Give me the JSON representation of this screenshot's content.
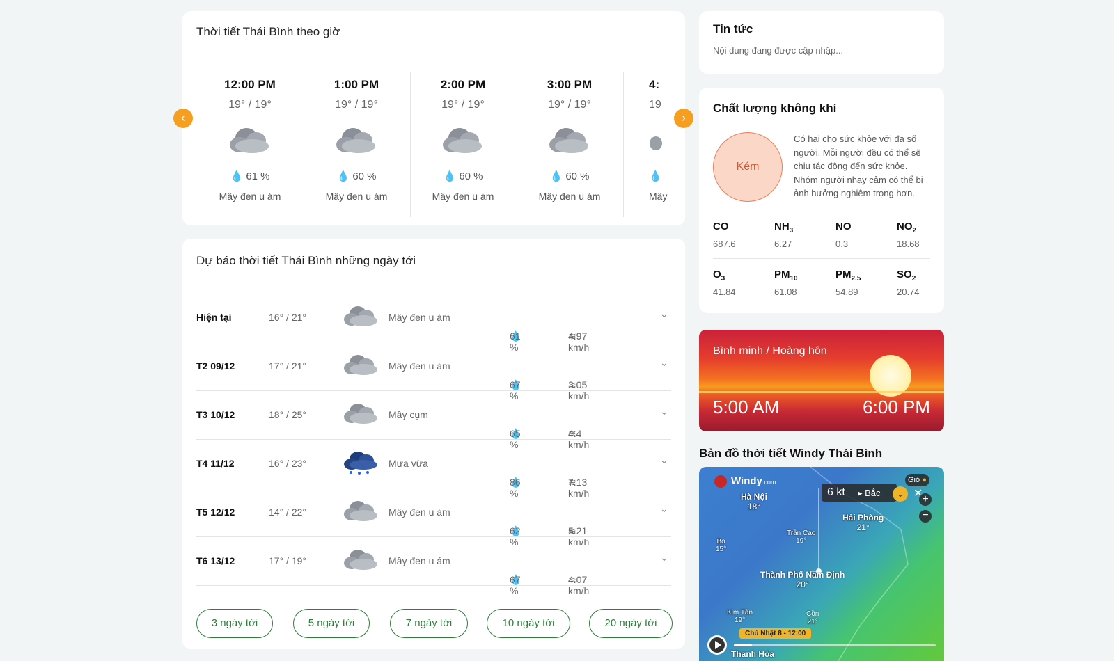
{
  "hourly": {
    "title": "Thời tiết Thái Bình theo giờ",
    "items": [
      {
        "time": "12:00 PM",
        "temp": "19° / 19°",
        "humidity": "61 %",
        "desc": "Mây đen u ám"
      },
      {
        "time": "1:00 PM",
        "temp": "19° / 19°",
        "humidity": "60 %",
        "desc": "Mây đen u ám"
      },
      {
        "time": "2:00 PM",
        "temp": "19° / 19°",
        "humidity": "60 %",
        "desc": "Mây đen u ám"
      },
      {
        "time": "3:00 PM",
        "temp": "19° / 19°",
        "humidity": "60 %",
        "desc": "Mây đen u ám"
      },
      {
        "time": "4:",
        "temp": "19",
        "humidity": "",
        "desc": "Mây"
      }
    ],
    "prev_label": "‹",
    "next_label": "›"
  },
  "forecast": {
    "title": "Dự báo thời tiết Thái Bình những ngày tới",
    "rows": [
      {
        "day": "Hiện tại",
        "temp": "16° / 21°",
        "desc": "Mây đen u ám",
        "humidity": "61 %",
        "wind": "4.97 km/h",
        "icon": "cloud-icon"
      },
      {
        "day": "T2 09/12",
        "temp": "17° / 21°",
        "desc": "Mây đen u ám",
        "humidity": "67 %",
        "wind": "3.05 km/h",
        "icon": "cloud-icon"
      },
      {
        "day": "T3 10/12",
        "temp": "18° / 25°",
        "desc": "Mây cụm",
        "humidity": "65 %",
        "wind": "4.4 km/h",
        "icon": "cloud-icon"
      },
      {
        "day": "T4 11/12",
        "temp": "16° / 23°",
        "desc": "Mưa vừa",
        "humidity": "86 %",
        "wind": "7.13 km/h",
        "icon": "rain-cloud-icon"
      },
      {
        "day": "T5 12/12",
        "temp": "14° / 22°",
        "desc": "Mây đen u ám",
        "humidity": "62 %",
        "wind": "5.21 km/h",
        "icon": "cloud-icon"
      },
      {
        "day": "T6 13/12",
        "temp": "17° / 19°",
        "desc": "Mây đen u ám",
        "humidity": "67 %",
        "wind": "4.07 km/h",
        "icon": "cloud-icon"
      }
    ],
    "ranges": [
      "3 ngày tới",
      "5 ngày tới",
      "7 ngày tới",
      "10 ngày tới",
      "20 ngày tới"
    ]
  },
  "news": {
    "title": "Tin tức",
    "subtitle": "Nội dung đang được cập nhập..."
  },
  "air": {
    "title": "Chất lượng không khí",
    "level": "Kém",
    "description": "Có hại cho sức khỏe với đa số người. Mỗi người đều có thể sẽ chịu tác động đến sức khỏe. Nhóm người nhạy cảm có thể bị ảnh hưởng nghiêm trọng hơn.",
    "pollutants": [
      {
        "name": "CO",
        "sub": "",
        "value": "687.6"
      },
      {
        "name": "NH",
        "sub": "3",
        "value": "6.27"
      },
      {
        "name": "NO",
        "sub": "",
        "value": "0.3"
      },
      {
        "name": "NO",
        "sub": "2",
        "value": "18.68"
      },
      {
        "name": "O",
        "sub": "3",
        "value": "41.84"
      },
      {
        "name": "PM",
        "sub": "10",
        "value": "61.08"
      },
      {
        "name": "PM",
        "sub": "2.5",
        "value": "54.89"
      },
      {
        "name": "SO",
        "sub": "2",
        "value": "20.74"
      }
    ],
    "colors": {
      "circle_bg": "#fbd7c8",
      "circle_border": "#ee7d57"
    }
  },
  "sun": {
    "title": "Bình minh / Hoàng hôn",
    "sunrise": "5:00 AM",
    "sunset": "6:00 PM"
  },
  "map": {
    "title": "Bản đồ thời tiết Windy Thái Bình",
    "brand": "Windy",
    "brand_suffix": "com",
    "layer": "Gió",
    "wind_value": "6 kt",
    "wind_dir": "Bắc",
    "time_label": "Chủ Nhật 8 - 12:00",
    "places": [
      {
        "name": "Hà Nội",
        "temp": "18°"
      },
      {
        "name": "Hải Phòng",
        "temp": "21°"
      },
      {
        "name": "Trần Cao",
        "temp": "19°"
      },
      {
        "name": "Bo",
        "temp": "15°"
      },
      {
        "name": "Thành Phố Nam Định",
        "temp": "20°"
      },
      {
        "name": "Kim Tân",
        "temp": "19°"
      },
      {
        "name": "Cồn",
        "temp": "21°"
      },
      {
        "name": "Thanh Hóa",
        "temp": ""
      }
    ]
  }
}
